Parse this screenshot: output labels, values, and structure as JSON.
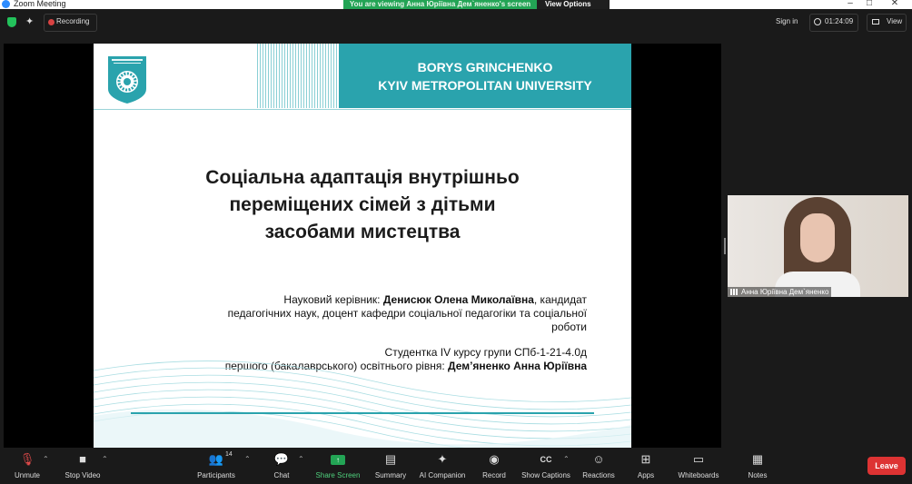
{
  "window": {
    "title": "Zoom Meeting",
    "viewing_banner": "You are viewing Анна Юріївна Дем`яненко's screen",
    "view_options": "View Options",
    "minimize": "–",
    "maximize": "□",
    "close": "✕"
  },
  "topbar": {
    "recording": "Recording",
    "sign_in": "Sign in",
    "timer": "01:24:09",
    "view": "View"
  },
  "slide": {
    "university": [
      "BORYS GRINCHENKO",
      "KYIV METROPOLITAN UNIVERSITY"
    ],
    "title": [
      "Соціальна адаптація внутрішньо",
      "переміщених сімей з дітьми",
      "засобами мистецтва"
    ],
    "supervisor_prefix": "Науковий керівник: ",
    "supervisor_name": "Денисюк Олена Миколаївна",
    "supervisor_rest": ", кандидат",
    "supervisor_line2": "педагогічних наук, доцент кафедри соціальної педагогіки та соціальної",
    "supervisor_line3": "роботи",
    "student_line1": "Студентка IV курсу групи СПб-1-21-4.0д",
    "student_prefix": "першого (бакалаврського) освітнього рівня: ",
    "student_name": "Дем’яненко Анна Юріївна"
  },
  "participant": {
    "name": "Анна Юріївна Дем`яненко"
  },
  "toolbar": {
    "unmute": "Unmute",
    "stop_video": "Stop Video",
    "participants": "Participants",
    "participants_count": "14",
    "chat": "Chat",
    "share_screen": "Share Screen",
    "summary": "Summary",
    "ai_companion": "AI Companion",
    "record": "Record",
    "show_captions": "Show Captions",
    "reactions": "Reactions",
    "apps": "Apps",
    "whiteboards": "Whiteboards",
    "notes": "Notes",
    "leave": "Leave"
  },
  "icons": {
    "unmute": "mic-muted-icon",
    "stop_video": "video-camera-icon",
    "participants": "people-icon",
    "chat": "chat-bubble-icon",
    "share_screen": "share-screen-icon",
    "summary": "summary-icon",
    "ai_companion": "sparkle-icon",
    "record": "record-icon",
    "show_captions": "cc-icon",
    "reactions": "emoji-icon",
    "apps": "apps-icon",
    "whiteboards": "whiteboard-icon",
    "notes": "notes-icon"
  },
  "colors": {
    "accent_teal": "#2aa3ad",
    "share_green": "#23a455",
    "leave_red": "#dd3333",
    "recording_red": "#d84242"
  }
}
